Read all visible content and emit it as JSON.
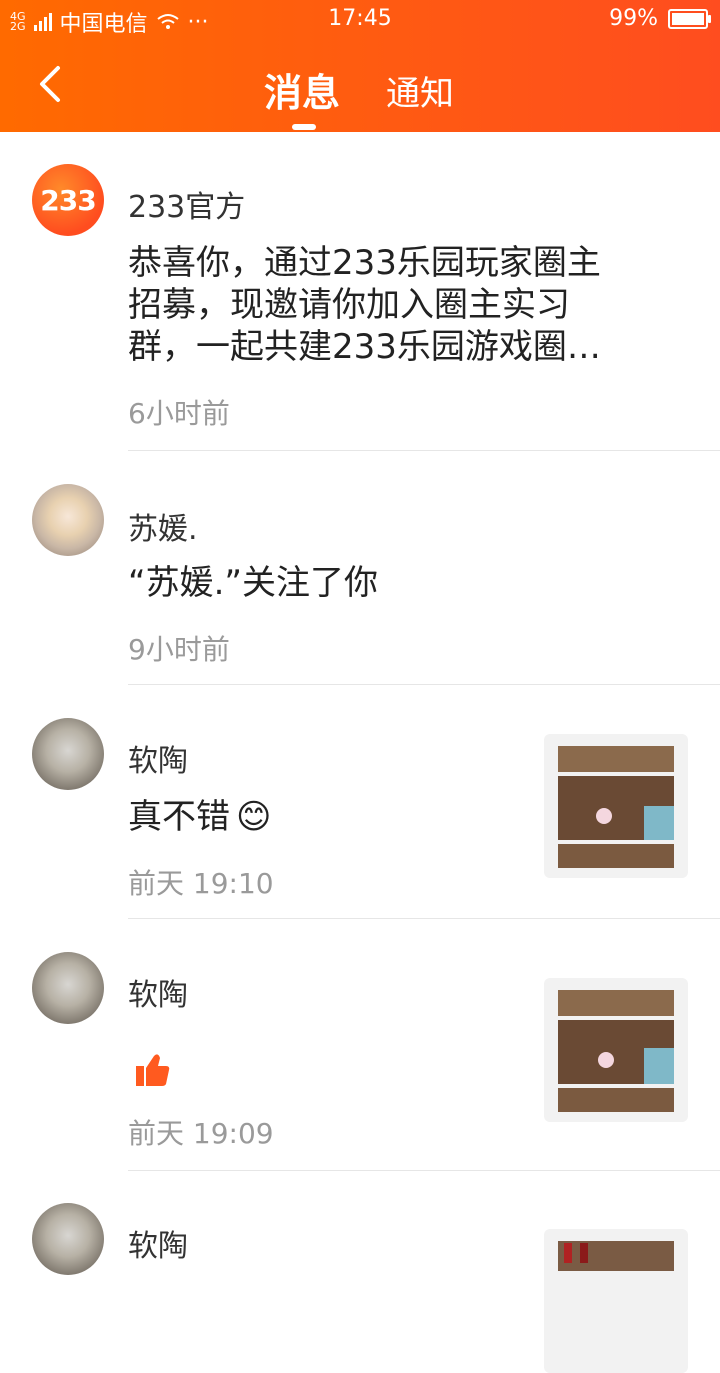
{
  "status_bar": {
    "network_top": "4G",
    "network_bottom": "2G",
    "carrier": "中国电信",
    "more": "···",
    "time": "17:45",
    "battery": "99%"
  },
  "header": {
    "tabs": [
      {
        "label": "消息",
        "active": true
      },
      {
        "label": "通知",
        "active": false
      }
    ]
  },
  "messages": [
    {
      "avatar_text": "233",
      "name": "233官方",
      "text_lines": [
        "恭喜你，通过233乐园玩家圈主",
        "招募，现邀请你加入圈主实习",
        "群，一起共建233乐园游戏圈…"
      ],
      "time": "6小时前"
    },
    {
      "name": "苏媛.",
      "text": "“苏媛.”关注了你",
      "time": "9小时前"
    },
    {
      "name": "软陶",
      "text": "真不错",
      "emoji": "😊",
      "time": "前天 19:10",
      "has_thumb": true
    },
    {
      "name": "软陶",
      "icon": "thumbs-up-icon",
      "time": "前天 19:09",
      "has_thumb": true
    },
    {
      "name": "软陶",
      "has_thumb": true
    }
  ],
  "colors": {
    "accent": "#ff5a12",
    "like": "#ff5a1f",
    "gray_text": "#9a9a9a"
  }
}
